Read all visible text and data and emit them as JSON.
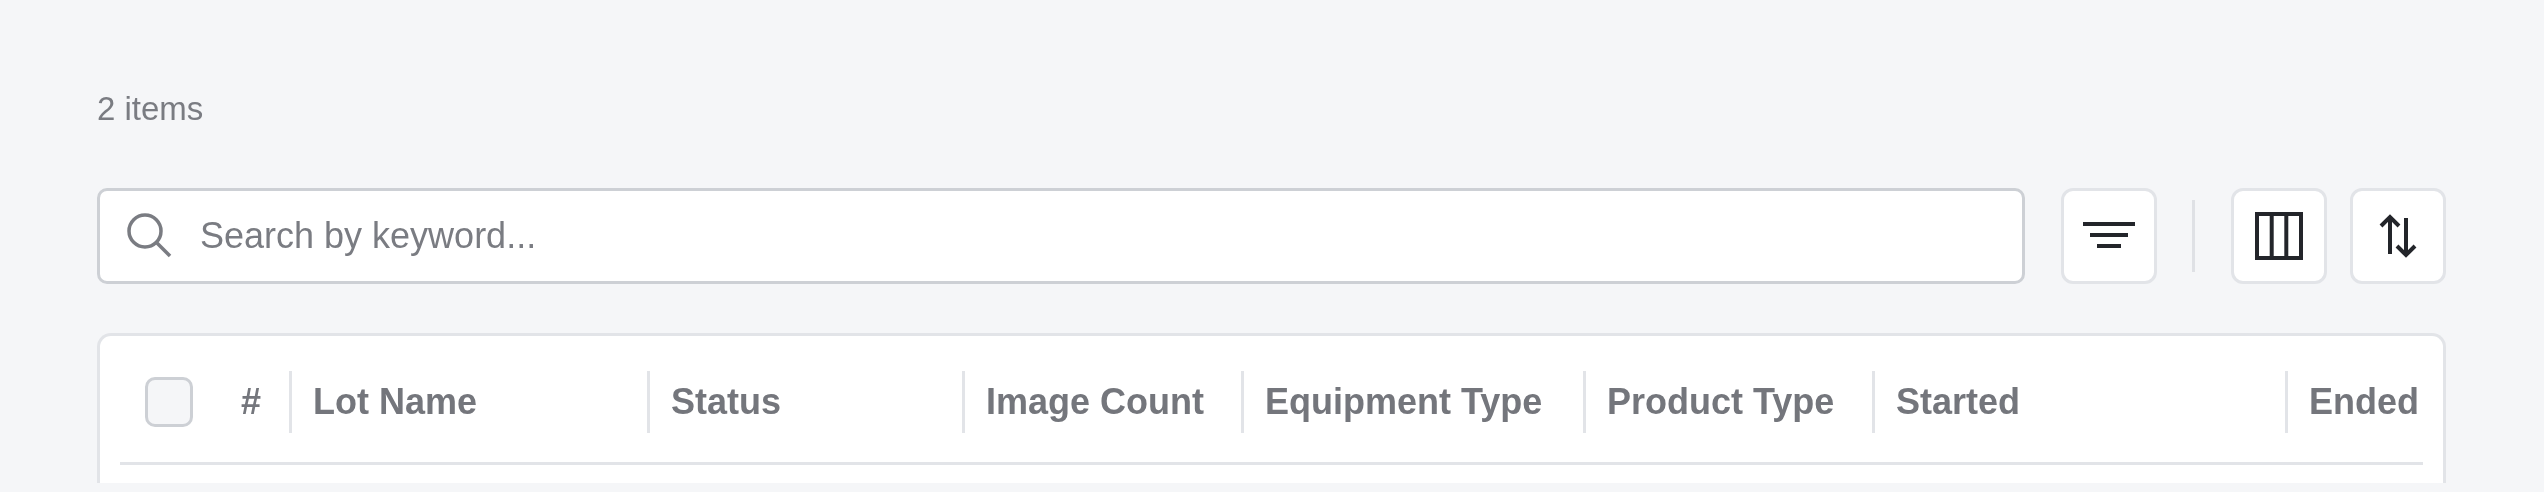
{
  "item_count": "2 items",
  "search": {
    "placeholder": "Search by keyword..."
  },
  "toolbar": [
    {
      "kind": "filter"
    },
    {
      "kind": "divider"
    },
    {
      "kind": "columns"
    },
    {
      "kind": "sort"
    }
  ],
  "table": {
    "select_all": {
      "checked": false
    },
    "columns": [
      {
        "label": "#"
      },
      {
        "label": "Lot Name"
      },
      {
        "label": "Status"
      },
      {
        "label": "Image Count"
      },
      {
        "label": "Equipment Type"
      },
      {
        "label": "Product Type"
      },
      {
        "label": "Started"
      },
      {
        "label": "Ended"
      }
    ]
  }
}
